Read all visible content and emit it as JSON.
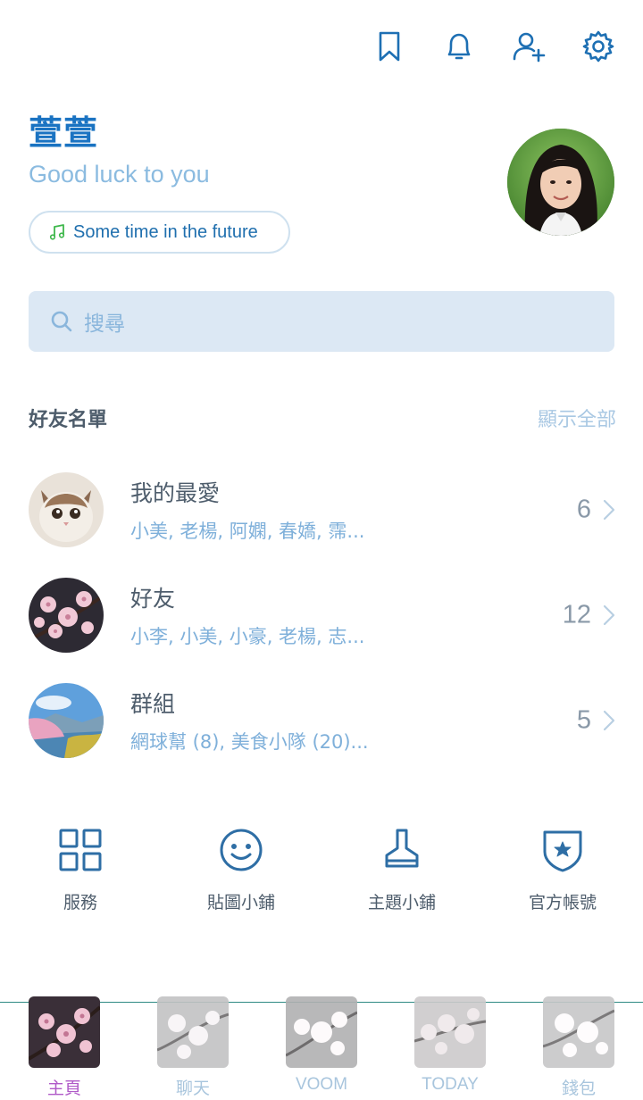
{
  "header": {
    "icons": [
      "bookmark-icon",
      "bell-icon",
      "add-friend-icon",
      "gear-icon"
    ]
  },
  "profile": {
    "name": "萱萱",
    "status_message": "Good luck to you",
    "music": "Some time in the future"
  },
  "search": {
    "placeholder": "搜尋"
  },
  "friends_section": {
    "title": "好友名單",
    "show_all": "顯示全部",
    "rows": [
      {
        "title": "我的最愛",
        "subtitle": "小美, 老楊, 阿嫻, 春嬌, 霈...",
        "count": "6"
      },
      {
        "title": "好友",
        "subtitle": "小李, 小美, 小豪, 老楊, 志...",
        "count": "12"
      },
      {
        "title": "群組",
        "subtitle": "網球幫 (8), 美食小隊 (20)...",
        "count": "5"
      }
    ]
  },
  "services": [
    {
      "label": "服務",
      "icon": "grid-icon"
    },
    {
      "label": "貼圖小鋪",
      "icon": "smiley-icon"
    },
    {
      "label": "主題小鋪",
      "icon": "brush-icon"
    },
    {
      "label": "官方帳號",
      "icon": "shield-star-icon"
    }
  ],
  "bottom_nav": [
    {
      "label": "主頁",
      "active": true
    },
    {
      "label": "聊天"
    },
    {
      "label": "VOOM"
    },
    {
      "label": "TODAY"
    },
    {
      "label": "錢包"
    }
  ],
  "colors": {
    "accent": "#1a73c2",
    "active_tab": "#b05ac8",
    "search_bg": "#dce8f4"
  }
}
